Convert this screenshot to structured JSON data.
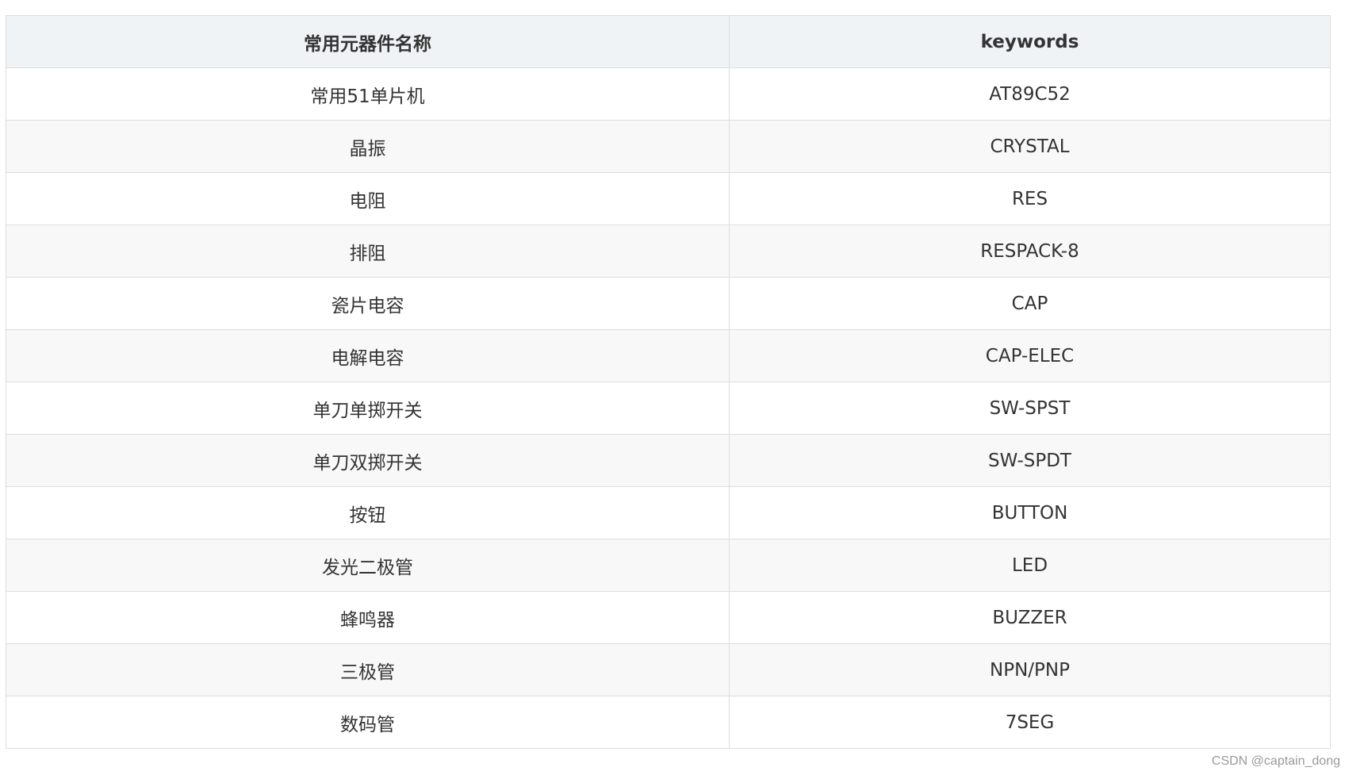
{
  "table": {
    "headers": {
      "name": "常用元器件名称",
      "keywords": "keywords"
    },
    "rows": [
      {
        "name": "常用51单片机",
        "keyword": "AT89C52"
      },
      {
        "name": "晶振",
        "keyword": "CRYSTAL"
      },
      {
        "name": "电阻",
        "keyword": "RES"
      },
      {
        "name": "排阻",
        "keyword": "RESPACK-8"
      },
      {
        "name": "瓷片电容",
        "keyword": "CAP"
      },
      {
        "name": "电解电容",
        "keyword": "CAP-ELEC"
      },
      {
        "name": "单刀单掷开关",
        "keyword": "SW-SPST"
      },
      {
        "name": "单刀双掷开关",
        "keyword": "SW-SPDT"
      },
      {
        "name": "按钮",
        "keyword": "BUTTON"
      },
      {
        "name": "发光二极管",
        "keyword": "LED"
      },
      {
        "name": "蜂鸣器",
        "keyword": "BUZZER"
      },
      {
        "name": "三极管",
        "keyword": "NPN/PNP"
      },
      {
        "name": "数码管",
        "keyword": "7SEG"
      }
    ]
  },
  "watermark": "CSDN @captain_dong",
  "colors": {
    "header_bg": "#eff3f5",
    "stripe_bg": "#f8f8f8",
    "border": "#dddddd",
    "text": "#333333"
  }
}
